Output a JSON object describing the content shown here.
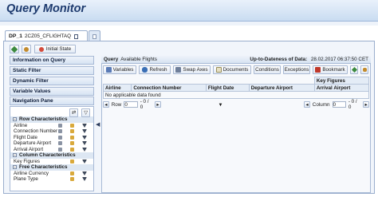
{
  "app": {
    "title": "Query Monitor"
  },
  "tab": {
    "name": "DP_1",
    "desc": "2CZ05_CFLIGHTAQ"
  },
  "toolbar": {
    "initial_state": "Initial State"
  },
  "left_panel": {
    "sections": [
      "Information on Query",
      "Static Filter",
      "Dynamic Filter",
      "Variable Values",
      "Navigation Pane"
    ],
    "nav": {
      "row_chars_title": "Row Characteristics",
      "row_chars": [
        "Airline",
        "Connection Number",
        "Flight Date",
        "Departure Airport",
        "Arrival Airport"
      ],
      "col_chars_title": "Column Characteristics",
      "col_chars": [
        "Key Figures"
      ],
      "free_chars_title": "Free Characteristics",
      "free_chars": [
        "Airline Currency",
        "Plane Type"
      ]
    }
  },
  "query_area": {
    "label": "Query",
    "query_name": "Available Flights",
    "update_label": "Up-to-Dateness of Data:",
    "update_value": "28.02.2017 06:37:50 CET",
    "buttons": [
      "Variables",
      "Refresh",
      "Swap Axes",
      "Documents",
      "Conditions",
      "Exceptions",
      "Bookmark"
    ],
    "key_figures_header": "Key Figures",
    "columns": [
      "Airline",
      "Connection Number",
      "Flight Date",
      "Departure Airport",
      "Arrival Airport"
    ],
    "empty_message": "No applicable data found",
    "row_nav": {
      "label": "Row",
      "value": "0",
      "range": "- 0 / 0"
    },
    "col_nav": {
      "label": "Column",
      "value": "0",
      "range": "- 0 / 0"
    }
  }
}
